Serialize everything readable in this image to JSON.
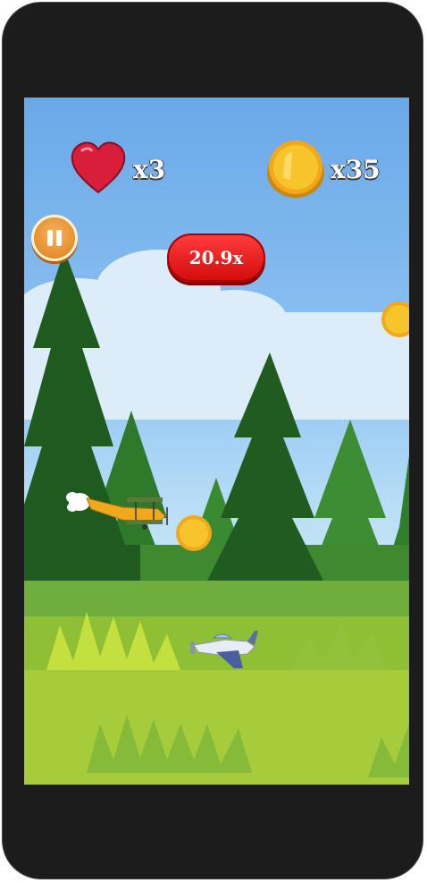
{
  "hud": {
    "lives_label": "x3",
    "coins_label": "x35",
    "lives_icon": "heart-icon",
    "coins_icon": "coin-icon"
  },
  "multiplier_label": "20.9x",
  "pause_icon": "pause-icon",
  "colors": {
    "sky": "#8fc4f3",
    "grass": "#9bc73a",
    "multiplier_bg": "#e01414",
    "pause_bg": "#f0a040",
    "coin": "#f7c21b",
    "heart": "#d81e3a"
  }
}
